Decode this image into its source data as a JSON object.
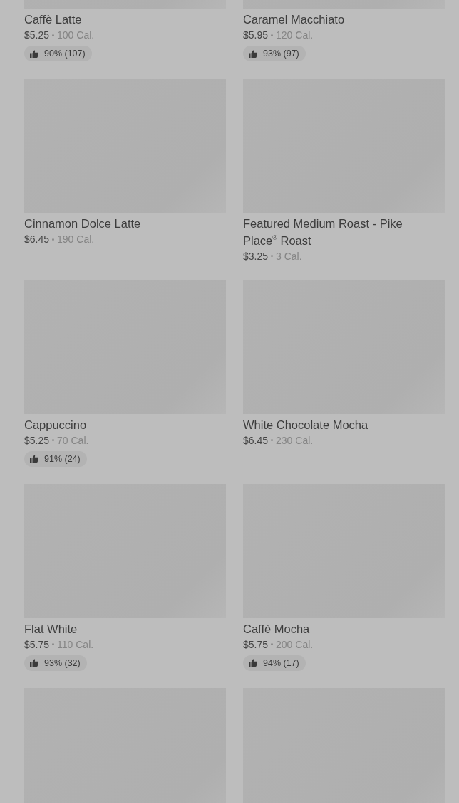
{
  "products": [
    {
      "kind": "placeholder",
      "name": "Caffè Latte",
      "price": "$5.25",
      "calories": "100 Cal.",
      "rating": "90% (107)"
    },
    {
      "kind": "placeholder",
      "name": "Caramel Macchiato",
      "price": "$5.95",
      "calories": "120 Cal.",
      "rating": "93% (97)"
    },
    {
      "kind": "placeholder",
      "name": "Cinnamon Dolce Latte",
      "price": "$6.45",
      "calories": "190 Cal."
    },
    {
      "kind": "placeholder",
      "name": "Featured Medium Roast - Pike Place$^{®}$ Roast",
      "price": "$3.25",
      "calories": "3 Cal."
    },
    {
      "kind": "placeholder",
      "name": "Cappuccino",
      "price": "$5.25",
      "calories": "70 Cal.",
      "rating": "91% (24)"
    },
    {
      "kind": "placeholder",
      "name": "White Chocolate Mocha",
      "price": "$6.45",
      "calories": "230 Cal."
    },
    {
      "kind": "placeholder",
      "name": "Flat White",
      "price": "$5.75",
      "calories": "110 Cal.",
      "rating": "93% (32)"
    },
    {
      "kind": "placeholder",
      "name": "Caffè Mocha",
      "price": "$5.75",
      "calories": "200 Cal.",
      "rating": "94% (17)"
    },
    {
      "kind": "placeholder"
    },
    {
      "kind": "placeholder"
    }
  ]
}
